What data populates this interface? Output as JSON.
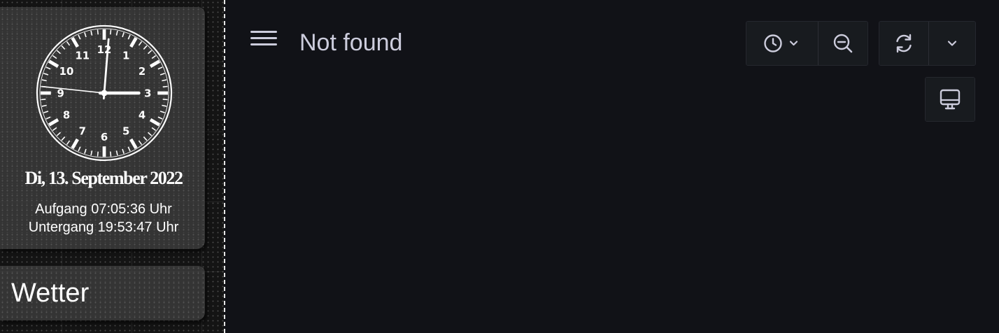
{
  "sidebar": {
    "clock": {
      "numbers": [
        "12",
        "1",
        "2",
        "3",
        "4",
        "5",
        "6",
        "7",
        "8",
        "9",
        "10",
        "11"
      ],
      "time": {
        "hour": 3,
        "minute": 0,
        "second": 46
      }
    },
    "date": "Di, 13. September 2022",
    "sunrise": "Aufgang 07:05:36 Uhr",
    "sunset": "Untergang 19:53:47 Uhr",
    "weather_title": "Wetter"
  },
  "header": {
    "menu_icon": "hamburger-icon",
    "title": "Not found"
  },
  "toolbar": {
    "time_picker_icon": "clock-icon",
    "time_picker_dropdown_icon": "chevron-down-icon",
    "zoom_out_icon": "zoom-out-icon",
    "refresh_icon": "refresh-icon",
    "refresh_interval_icon": "chevron-down-icon",
    "tv_mode_icon": "monitor-icon"
  },
  "colors": {
    "app_background": "#111217",
    "text_primary": "#ccccdc",
    "button_background": "#181b1f",
    "button_border": "#25272e",
    "sidebar_card": "#3e3e3e"
  }
}
